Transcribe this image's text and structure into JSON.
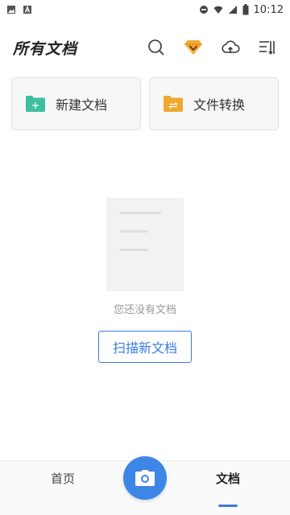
{
  "status_bar": {
    "time": "10:12",
    "icons": [
      "image-icon",
      "a-icon",
      "dnd-icon",
      "wifi-icon",
      "signal-icon",
      "battery-icon"
    ]
  },
  "header": {
    "title": "所有文档",
    "actions": [
      "search-icon",
      "vip-diamond-icon",
      "cloud-upload-icon",
      "sort-icon"
    ]
  },
  "cards": [
    {
      "label": "新建文档",
      "icon": "new-folder-icon",
      "color": "#3cc0a0"
    },
    {
      "label": "文件转换",
      "icon": "convert-folder-icon",
      "color": "#f0a830"
    }
  ],
  "empty_state": {
    "message": "您还没有文档",
    "button_label": "扫描新文档"
  },
  "bottom_nav": {
    "home_label": "首页",
    "docs_label": "文档",
    "active": "docs",
    "accent": "#3a7be0"
  }
}
